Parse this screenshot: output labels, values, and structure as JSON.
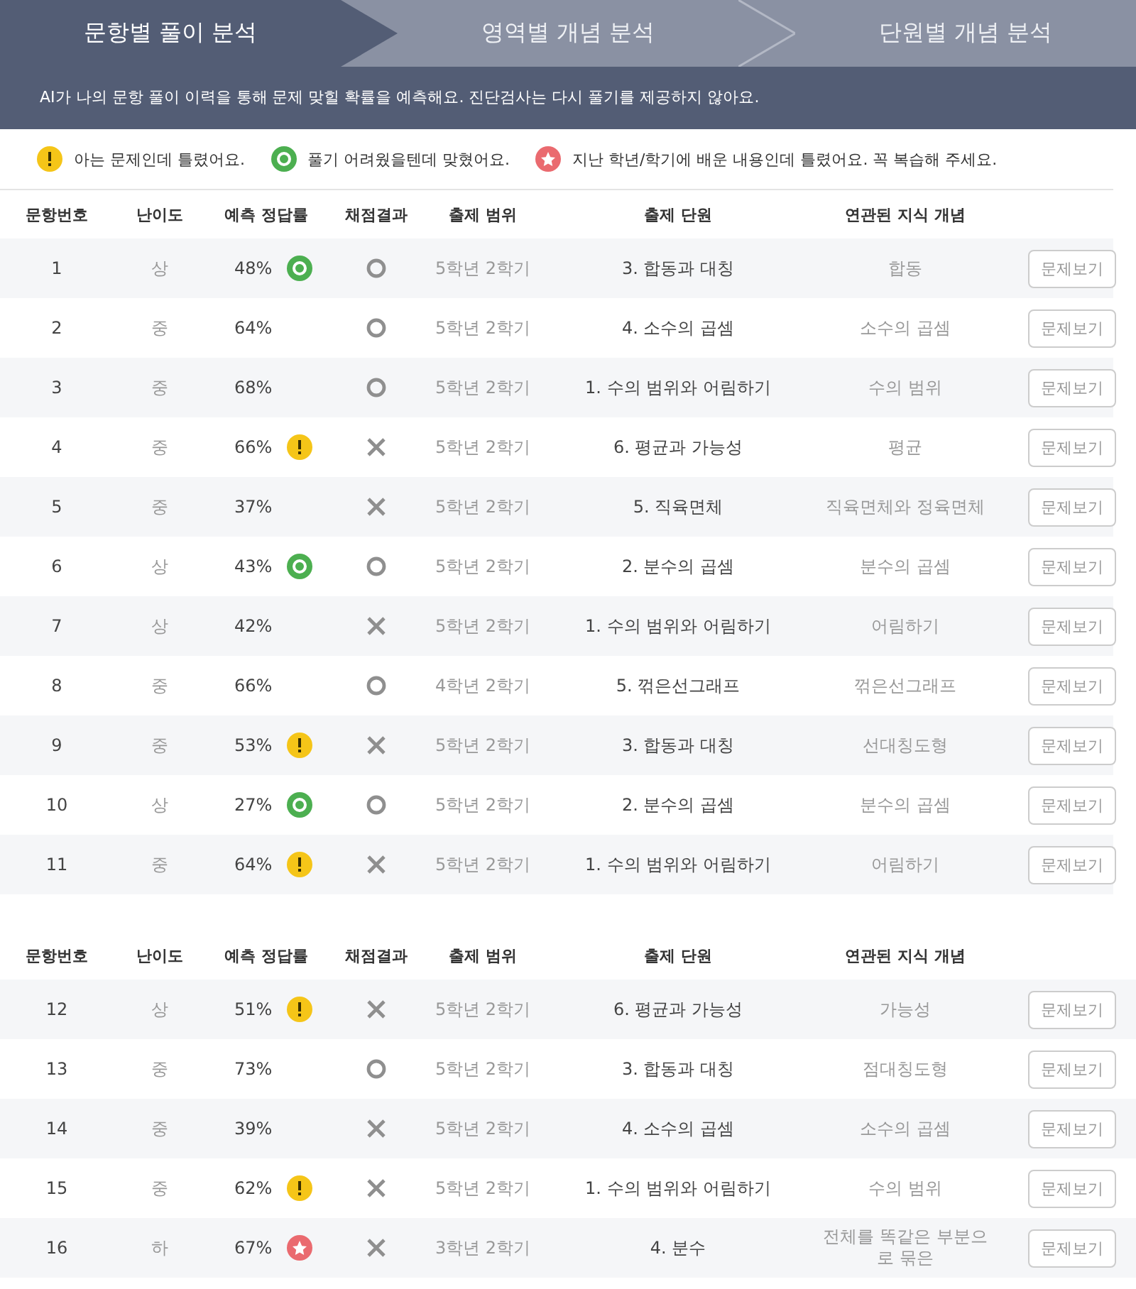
{
  "tabs": [
    {
      "label": "문항별 풀이 분석",
      "selected": true
    },
    {
      "label": "영역별 개념 분석",
      "selected": false
    },
    {
      "label": "단원별 개념 분석",
      "selected": false
    }
  ],
  "notice": "AI가 나의 문항 풀이 이력을 통해 문제 맞힐 확률을 예측해요. 진단검사는 다시 풀기를 제공하지 않아요.",
  "legend": [
    {
      "kind": "known_wrong",
      "text": "아는 문제인데 틀렸어요."
    },
    {
      "kind": "hard_correct",
      "text": "풀기 어려웠을텐데 맞혔어요."
    },
    {
      "kind": "review",
      "text": "지난 학년/학기에 배운 내용인데 틀렸어요. 꼭 복습해 주세요."
    }
  ],
  "tables": [
    {
      "columns": [
        "문항번호",
        "난이도",
        "예측 정답률",
        "채점결과",
        "출제 범위",
        "출제 단원",
        "연관된 지식 개념"
      ],
      "rows": [
        {
          "number": "1",
          "difficulty": "상",
          "rate": "48%",
          "badge": {
            "kind": "hard_correct"
          },
          "correct": true,
          "range": "5학년 2학기",
          "unit": "3. 합동과 대칭",
          "concept": "합동",
          "button": "문제보기"
        },
        {
          "number": "2",
          "difficulty": "중",
          "rate": "64%",
          "correct": true,
          "range": "5학년 2학기",
          "unit": "4. 소수의 곱셈",
          "concept": "소수의 곱셈",
          "button": "문제보기"
        },
        {
          "number": "3",
          "difficulty": "중",
          "rate": "68%",
          "correct": true,
          "range": "5학년 2학기",
          "unit": "1. 수의 범위와 어림하기",
          "concept": "수의 범위",
          "button": "문제보기"
        },
        {
          "number": "4",
          "difficulty": "중",
          "rate": "66%",
          "badge": {
            "kind": "known_wrong"
          },
          "correct": false,
          "range": "5학년 2학기",
          "unit": "6. 평균과 가능성",
          "concept": "평균",
          "button": "문제보기"
        },
        {
          "number": "5",
          "difficulty": "중",
          "rate": "37%",
          "correct": false,
          "range": "5학년 2학기",
          "unit": "5. 직육면체",
          "concept": "직육면체와 정육면체",
          "button": "문제보기"
        },
        {
          "number": "6",
          "difficulty": "상",
          "rate": "43%",
          "badge": {
            "kind": "hard_correct"
          },
          "correct": true,
          "range": "5학년 2학기",
          "unit": "2. 분수의 곱셈",
          "concept": "분수의 곱셈",
          "button": "문제보기"
        },
        {
          "number": "7",
          "difficulty": "상",
          "rate": "42%",
          "correct": false,
          "range": "5학년 2학기",
          "unit": "1. 수의 범위와 어림하기",
          "concept": "어림하기",
          "button": "문제보기"
        },
        {
          "number": "8",
          "difficulty": "중",
          "rate": "66%",
          "correct": true,
          "range": "4학년 2학기",
          "unit": "5. 꺾은선그래프",
          "concept": "꺾은선그래프",
          "button": "문제보기"
        },
        {
          "number": "9",
          "difficulty": "중",
          "rate": "53%",
          "badge": {
            "kind": "known_wrong"
          },
          "correct": false,
          "range": "5학년 2학기",
          "unit": "3. 합동과 대칭",
          "concept": "선대칭도형",
          "button": "문제보기"
        },
        {
          "number": "10",
          "difficulty": "상",
          "rate": "27%",
          "badge": {
            "kind": "hard_correct"
          },
          "correct": true,
          "range": "5학년 2학기",
          "unit": "2. 분수의 곱셈",
          "concept": "분수의 곱셈",
          "button": "문제보기"
        },
        {
          "number": "11",
          "difficulty": "중",
          "rate": "64%",
          "badge": {
            "kind": "known_wrong"
          },
          "correct": false,
          "range": "5학년 2학기",
          "unit": "1. 수의 범위와 어림하기",
          "concept": "어림하기",
          "button": "문제보기"
        }
      ]
    },
    {
      "columns": [
        "문항번호",
        "난이도",
        "예측 정답률",
        "채점결과",
        "출제 범위",
        "출제 단원",
        "연관된 지식 개념"
      ],
      "rows": [
        {
          "number": "12",
          "difficulty": "상",
          "rate": "51%",
          "badge": {
            "kind": "known_wrong"
          },
          "correct": false,
          "range": "5학년 2학기",
          "unit": "6. 평균과 가능성",
          "concept": "가능성",
          "button": "문제보기"
        },
        {
          "number": "13",
          "difficulty": "중",
          "rate": "73%",
          "correct": true,
          "range": "5학년 2학기",
          "unit": "3. 합동과 대칭",
          "concept": "점대칭도형",
          "button": "문제보기"
        },
        {
          "number": "14",
          "difficulty": "중",
          "rate": "39%",
          "correct": false,
          "range": "5학년 2학기",
          "unit": "4. 소수의 곱셈",
          "concept": "소수의 곱셈",
          "button": "문제보기"
        },
        {
          "number": "15",
          "difficulty": "중",
          "rate": "62%",
          "badge": {
            "kind": "known_wrong"
          },
          "correct": false,
          "range": "5학년 2학기",
          "unit": "1. 수의 범위와 어림하기",
          "concept": "수의 범위",
          "button": "문제보기"
        },
        {
          "number": "16",
          "difficulty": "하",
          "rate": "67%",
          "badge": {
            "kind": "review"
          },
          "correct": false,
          "range": "3학년 2학기",
          "unit": "4. 분수",
          "concept": "전체를 똑같은 부분으로 묶은",
          "button": "문제보기"
        }
      ]
    }
  ]
}
